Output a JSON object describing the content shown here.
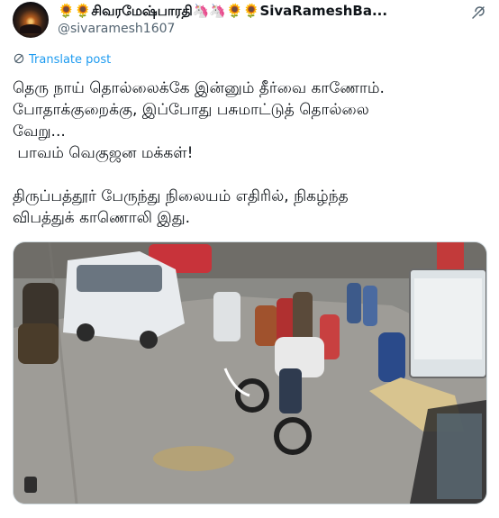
{
  "tweet": {
    "author_name": "🌻🌻சிவரமேஷ்பாரதி🦄🦄🌻🌻SivaRameshBa...",
    "handle": "@sivaramesh1607",
    "translate_label": "Translate post",
    "text": "தெரு நாய் தொல்லைக்கே இன்னும் தீர்வை காணோம்.\nபோதாக்குறைக்கு, இப்போது பசுமாட்டுத் தொல்லை\nவேறு...\n பாவம் வெகுஜன மக்கள்!\n\nதிருப்பத்தூர் பேருந்து நிலையம் எதிரில், நிகழ்ந்த\nவிபத்துக் காணொலி இது."
  },
  "icons": {
    "grok": "grok-icon",
    "translate": "translate-icon",
    "media_badge": "media-badge-icon"
  },
  "colors": {
    "link": "#1d9bf0",
    "secondary_text": "#536471",
    "primary_text": "#0f1419"
  }
}
